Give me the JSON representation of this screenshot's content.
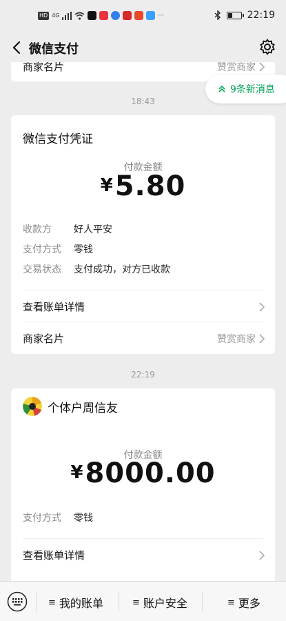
{
  "status_bar": {
    "network_tag": "HD",
    "network_gen": "4G",
    "time": "22:19",
    "battery_level": 0.35,
    "more_dots": "···"
  },
  "nav": {
    "title": "微信支付"
  },
  "top_card": {
    "label": "商家名片",
    "right_text": "赞赏商家"
  },
  "new_messages": {
    "label": "9条新消息"
  },
  "message1": {
    "time": "18:43",
    "title": "微信支付凭证",
    "amount_label": "付款金额",
    "currency": "¥",
    "amount": "5.80",
    "details": [
      {
        "key": "收款方",
        "value": "好人平安"
      },
      {
        "key": "支付方式",
        "value": "零钱"
      },
      {
        "key": "交易状态",
        "value": "支付成功，对方已收款"
      }
    ],
    "bill_link": "查看账单详情",
    "merchant_card_label": "商家名片",
    "merchant_card_right": "赞赏商家"
  },
  "message2": {
    "time": "22:19",
    "merchant_name": "个体户周信友",
    "amount_label": "付款金额",
    "currency": "¥",
    "amount": "8000.00",
    "details": [
      {
        "key": "支付方式",
        "value": "零钱"
      }
    ],
    "bill_link": "查看账单详情"
  },
  "bottom_bar": {
    "items": [
      {
        "label": "我的账单"
      },
      {
        "label": "账户安全"
      },
      {
        "label": "更多"
      }
    ]
  },
  "colors": {
    "background": "#ededed",
    "accent_green": "#07a35a",
    "muted_text": "#888888"
  }
}
